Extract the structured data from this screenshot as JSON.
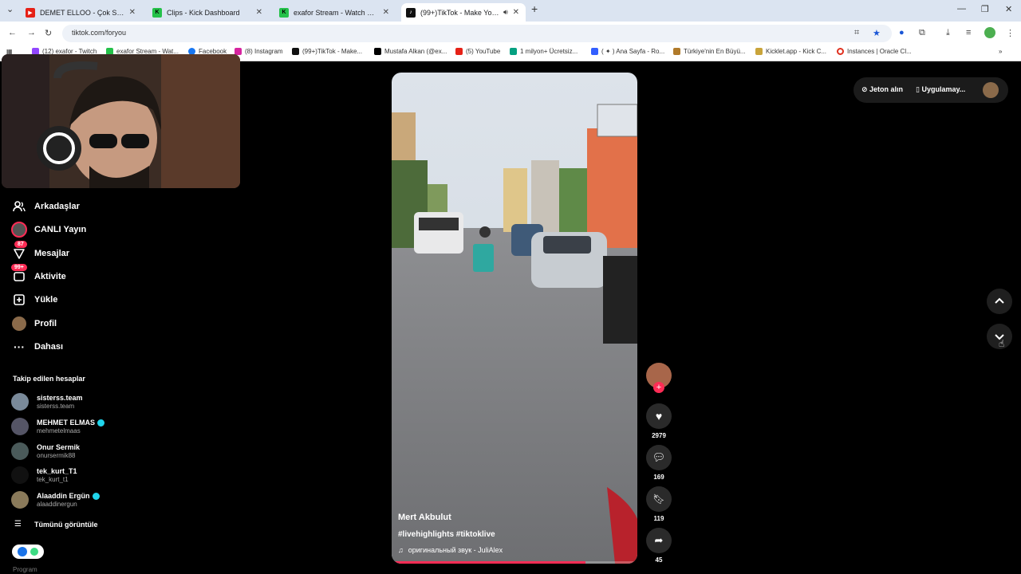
{
  "tabs": [
    {
      "title": "DEMET ELLOO - Çok Sevdik - Y",
      "fav_color": "#e62117"
    },
    {
      "title": "Clips - Kick Dashboard",
      "fav_color": "#25c14a",
      "fav_letter": "K"
    },
    {
      "title": "exafor Stream - Watch Live on K",
      "fav_color": "#25c14a",
      "fav_letter": "K"
    },
    {
      "title": "(99+)TikTok - Make Your Da",
      "fav_color": "#111111"
    }
  ],
  "omnibox_text": "tiktok.com/foryou",
  "bookmarks": [
    "(12) exafor - Twitch",
    "exafor Stream - Wat...",
    "Facebook",
    "(8) Instagram",
    "(99+)TikTok - Make...",
    "Mustafa Alkan (@ex...",
    "(5) YouTube",
    "1 milyon+ Ücretsiz...",
    "( ✦ ) Ana Sayfa - Ro...",
    "Türkiye'nin En Büyü...",
    "Kicklet.app - Kick C...",
    "Instances | Oracle Cl..."
  ],
  "nav": {
    "friends": "Arkadaşlar",
    "live": "CANLI Yayın",
    "messages": "Mesajlar",
    "messages_badge": "87",
    "activity": "Aktivite",
    "activity_badge": "99+",
    "upload": "Yükle",
    "profile": "Profil",
    "more": "Dahası"
  },
  "followed_title": "Takip edilen hesaplar",
  "accounts": [
    {
      "name": "sisterss.team",
      "user": "sisterss.team",
      "verified": false
    },
    {
      "name": "MEHMET ELMAS",
      "user": "mehmetelmaas",
      "verified": true
    },
    {
      "name": "Onur Sermik",
      "user": "onursermik88",
      "verified": false
    },
    {
      "name": "tek_kurt_T1",
      "user": "tek_kurt_t1",
      "verified": false
    },
    {
      "name": "Alaaddin Ergün",
      "user": "alaaddinergun",
      "verified": true
    }
  ],
  "see_all": "Tümünü görüntüle",
  "bottom_label": "Program",
  "topright": {
    "coins": "Jeton alın",
    "app": "Uygulamay..."
  },
  "video": {
    "author": "Mert Akbulut",
    "tags": "#livehighlights #tiktoklive",
    "music": "оригинальный звук - JuliAlex",
    "progress": 0.79
  },
  "actions": {
    "likes": "2979",
    "comments": "169",
    "saves": "119",
    "shares": "45"
  },
  "colors": {
    "accent": "#fe2c55",
    "verified": "#20d5ec"
  }
}
